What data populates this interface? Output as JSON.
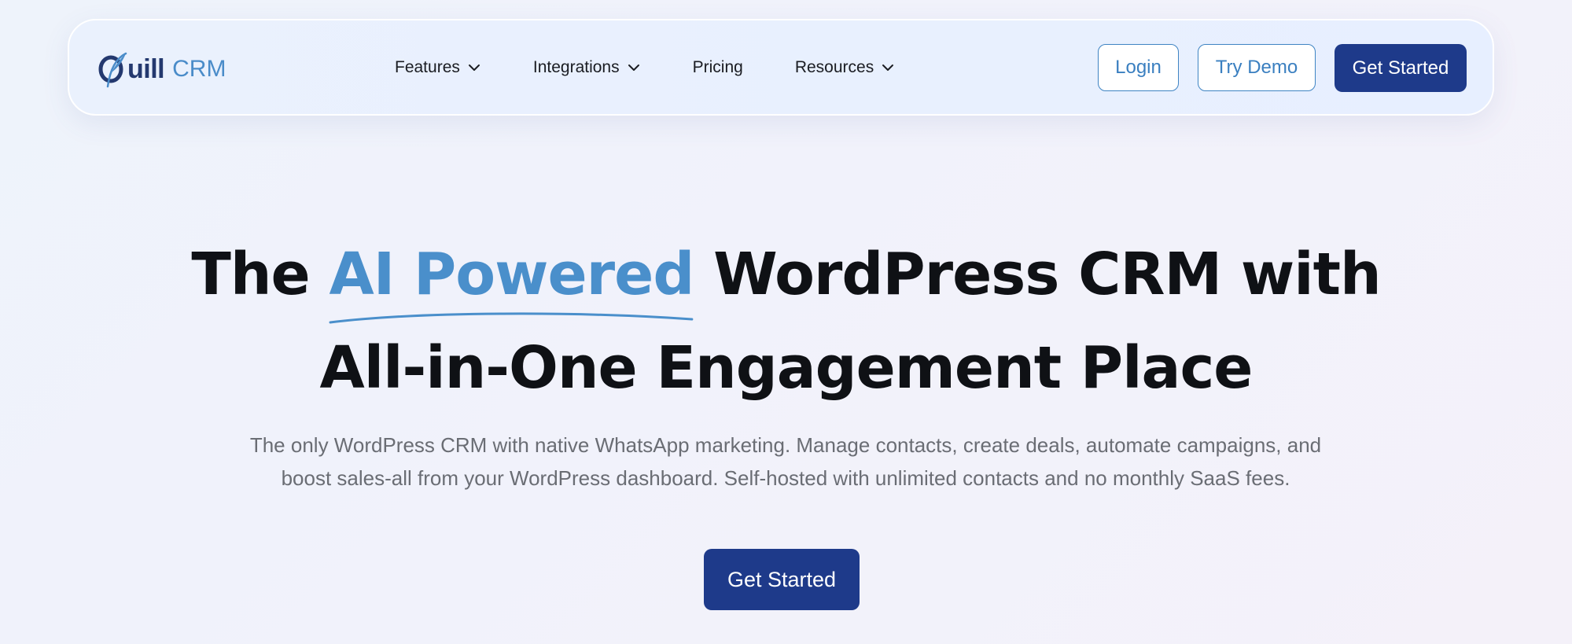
{
  "brand": {
    "name_part": "uill",
    "product": "CRM",
    "colors": {
      "navy": "#1e3a8a",
      "accent_blue": "#4a8fcb",
      "logo_dark": "#24396f"
    }
  },
  "nav": {
    "items": [
      {
        "label": "Features",
        "has_dropdown": true,
        "icon": "chevron-down-icon"
      },
      {
        "label": "Integrations",
        "has_dropdown": true,
        "icon": "chevron-down-icon"
      },
      {
        "label": "Pricing",
        "has_dropdown": false
      },
      {
        "label": "Resources",
        "has_dropdown": true,
        "icon": "chevron-down-icon"
      }
    ],
    "login_label": "Login",
    "demo_label": "Try Demo",
    "cta_label": "Get Started"
  },
  "hero": {
    "title_prefix": "The",
    "title_highlight": "AI Powered",
    "title_suffix": "WordPress CRM with",
    "title_line2": "All-in-One Engagement Place",
    "subtitle": "The only WordPress CRM with native WhatsApp marketing. Manage contacts, create deals, automate campaigns, and boost sales-all from your WordPress dashboard. Self-hosted with unlimited contacts and no monthly SaaS fees.",
    "cta_label": "Get Started"
  }
}
